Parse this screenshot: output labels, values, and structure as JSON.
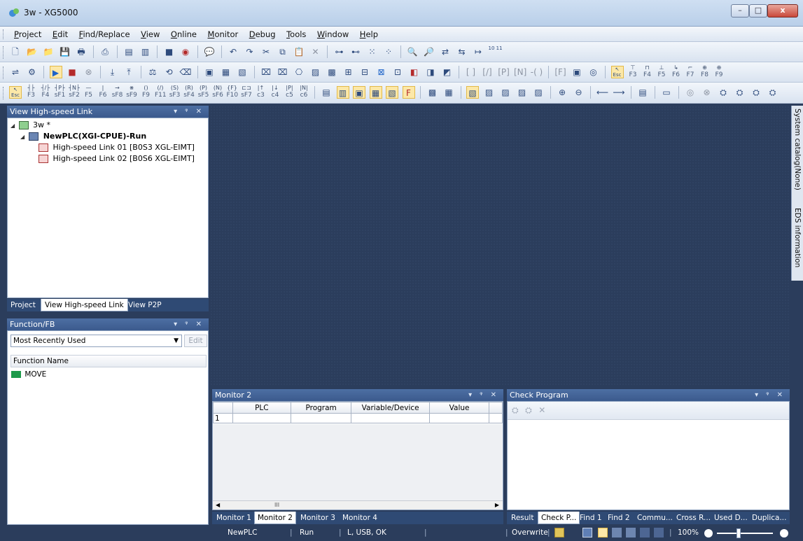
{
  "window": {
    "title": "3w - XG5000",
    "minimize_glyph": "–",
    "maximize_glyph": "□",
    "close_glyph": "x"
  },
  "menu": [
    "Project",
    "Edit",
    "Find/Replace",
    "View",
    "Online",
    "Monitor",
    "Debug",
    "Tools",
    "Window",
    "Help"
  ],
  "fkeys": {
    "row1": [
      "Esc",
      "F3",
      "F4",
      "sF1",
      "sF2",
      "F5",
      "F6",
      "sF8",
      "sF9",
      "F9",
      "F11",
      "sF3",
      "sF4",
      "sF5",
      "sF6",
      "F10",
      "sF7",
      "c3",
      "c4",
      "c5",
      "c6"
    ],
    "row2": [
      "Esc",
      "F3",
      "F4",
      "F5",
      "F6",
      "F7",
      "F8",
      "F9"
    ],
    "toolbar1_counter": "10 11"
  },
  "hs_panel": {
    "title": "View High-speed Link",
    "controls": "▾ ᵠ ✕",
    "root": "3w *",
    "plc": "NewPLC(XGI-CPUE)-Run",
    "links": [
      "High-speed Link 01 [B0S3 XGL-EIMT]",
      "High-speed Link 02 [B0S6 XGL-EIMT]"
    ]
  },
  "left_tabs": [
    "Project",
    "View High-speed Link",
    "View P2P"
  ],
  "fb_panel": {
    "title": "Function/FB",
    "controls": "▾ ᵠ ✕",
    "selected": "Most Recently Used",
    "edit_label": "Edit",
    "column": "Function Name",
    "items": [
      "MOVE"
    ]
  },
  "right_vtabs": [
    "System catalog(None)",
    "EDS information"
  ],
  "monitor": {
    "title": "Monitor 2",
    "controls": "▾ ᵠ ✕",
    "columns": [
      "",
      "PLC",
      "Program",
      "Variable/Device",
      "Value",
      ""
    ],
    "rows": [
      [
        "1",
        "",
        "",
        "",
        "",
        ""
      ]
    ],
    "scroll_thumb": "III",
    "tabs": [
      "Monitor 1",
      "Monitor 2",
      "Monitor 3",
      "Monitor 4"
    ]
  },
  "check": {
    "title": "Check Program",
    "controls": "▾ ᵠ ✕",
    "tabs": [
      "Result",
      "Check P...",
      "Find 1",
      "Find 2",
      "Commu...",
      "Cross R...",
      "Used D...",
      "Duplica..."
    ]
  },
  "status": {
    "plc": "NewPLC",
    "mode": "Run",
    "conn": "L, USB, OK",
    "edit_mode": "Overwrite",
    "zoom": "100%"
  }
}
